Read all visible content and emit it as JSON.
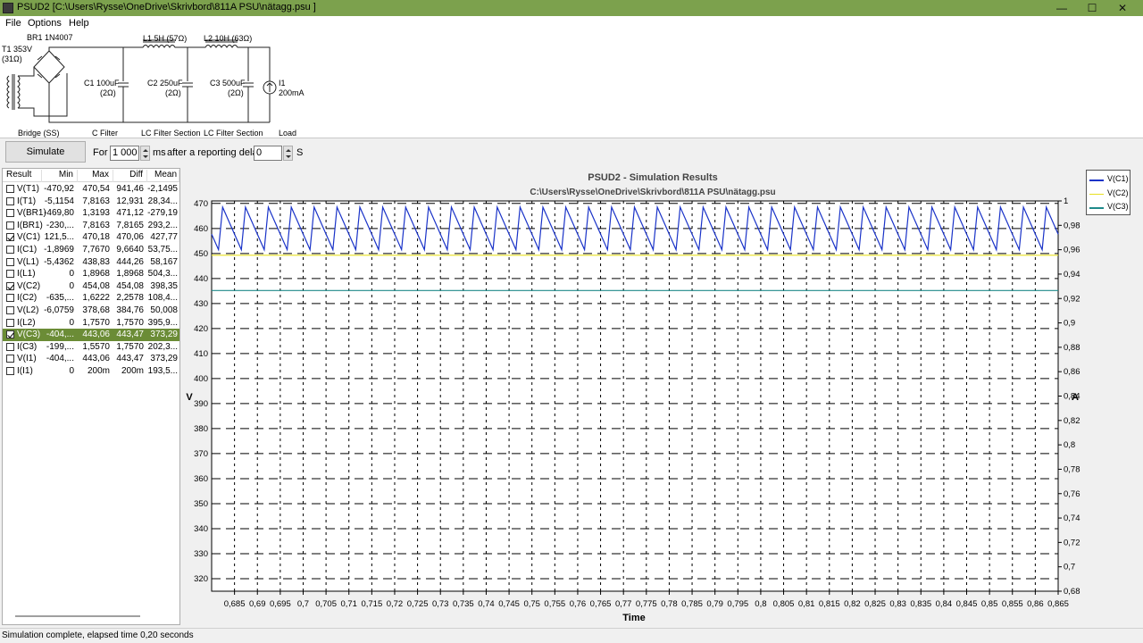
{
  "window": {
    "title": "PSUD2  [C:\\Users\\Rysse\\OneDrive\\Skrivbord\\811A PSU\\nätagg.psu ]",
    "btn_min": "—",
    "btn_max": "☐",
    "btn_close": "✕"
  },
  "menu": {
    "items": [
      "File",
      "Options",
      "Help"
    ]
  },
  "schematic": {
    "transformer": "T1 353V",
    "transformer_res": "(31Ω)",
    "bridge": "BR1 1N4007",
    "l1": "L1 5H (57Ω)",
    "l2": "L2 10H (63Ω)",
    "c1": "C1 100uF",
    "c1_res": "(2Ω)",
    "c2": "C2 250uF",
    "c2_res": "(2Ω)",
    "c3": "C3 500uF",
    "c3_res": "(2Ω)",
    "i1": "I1",
    "i1_val": "200mA",
    "sec_bridge": "Bridge (SS)",
    "sec_cfilter": "C Filter",
    "sec_lc1": "LC Filter Section",
    "sec_lc2": "LC Filter Section",
    "sec_load": "Load"
  },
  "toolbar": {
    "simulate": "Simulate",
    "for_label": "For",
    "duration": "1 000",
    "ms_label": "ms",
    "after_label": "after a reporting delay of",
    "delay": "0",
    "s_label": "S"
  },
  "results": {
    "headers": [
      "Result",
      "Min",
      "Max",
      "Diff",
      "Mean"
    ],
    "rows": [
      {
        "name": "V(T1)",
        "min": "-470,92",
        "max": "470,54",
        "diff": "941,46",
        "mean": "-2,1495",
        "checked": false,
        "selected": false
      },
      {
        "name": "I(T1)",
        "min": "-5,1154",
        "max": "7,8163",
        "diff": "12,931",
        "mean": "28,34...",
        "checked": false,
        "selected": false
      },
      {
        "name": "V(BR1)",
        "min": "-469,80",
        "max": "1,3193",
        "diff": "471,12",
        "mean": "-279,19",
        "checked": false,
        "selected": false
      },
      {
        "name": "I(BR1)",
        "min": "-230,...",
        "max": "7,8163",
        "diff": "7,8165",
        "mean": "293,2...",
        "checked": false,
        "selected": false
      },
      {
        "name": "V(C1)",
        "min": "121,5...",
        "max": "470,18",
        "diff": "470,06",
        "mean": "427,77",
        "checked": true,
        "selected": false
      },
      {
        "name": "I(C1)",
        "min": "-1,8969",
        "max": "7,7670",
        "diff": "9,6640",
        "mean": "53,75...",
        "checked": false,
        "selected": false
      },
      {
        "name": "V(L1)",
        "min": "-5,4362",
        "max": "438,83",
        "diff": "444,26",
        "mean": "58,167",
        "checked": false,
        "selected": false
      },
      {
        "name": "I(L1)",
        "min": "0",
        "max": "1,8968",
        "diff": "1,8968",
        "mean": "504,3...",
        "checked": false,
        "selected": false
      },
      {
        "name": "V(C2)",
        "min": "0",
        "max": "454,08",
        "diff": "454,08",
        "mean": "398,35",
        "checked": true,
        "selected": false
      },
      {
        "name": "I(C2)",
        "min": "-635,...",
        "max": "1,6222",
        "diff": "2,2578",
        "mean": "108,4...",
        "checked": false,
        "selected": false
      },
      {
        "name": "V(L2)",
        "min": "-6,0759",
        "max": "378,68",
        "diff": "384,76",
        "mean": "50,008",
        "checked": false,
        "selected": false
      },
      {
        "name": "I(L2)",
        "min": "0",
        "max": "1,7570",
        "diff": "1,7570",
        "mean": "395,9...",
        "checked": false,
        "selected": false
      },
      {
        "name": "V(C3)",
        "min": "-404,...",
        "max": "443,06",
        "diff": "443,47",
        "mean": "373,29",
        "checked": true,
        "selected": true
      },
      {
        "name": "I(C3)",
        "min": "-199,...",
        "max": "1,5570",
        "diff": "1,7570",
        "mean": "202,3...",
        "checked": false,
        "selected": false
      },
      {
        "name": "V(I1)",
        "min": "-404,...",
        "max": "443,06",
        "diff": "443,47",
        "mean": "373,29",
        "checked": false,
        "selected": false
      },
      {
        "name": "I(I1)",
        "min": "0",
        "max": "200m",
        "diff": "200m",
        "mean": "193,5...",
        "checked": false,
        "selected": false
      }
    ]
  },
  "status": {
    "text": "Simulation complete, elapsed time 0,20 seconds"
  },
  "chart_data": {
    "type": "line",
    "title": "PSUD2 - Simulation Results",
    "subtitle": "C:\\Users\\Rysse\\OneDrive\\Skrivbord\\811A PSU\\nätagg.psu",
    "xlabel": "Time",
    "ylabel": "V",
    "y2label": "A",
    "xlim": [
      0.68,
      0.865
    ],
    "ylim": [
      315,
      471
    ],
    "y2lim": [
      0.68,
      1.0
    ],
    "x_ticks": [
      "0,685",
      "0,69",
      "0,695",
      "0,7",
      "0,705",
      "0,71",
      "0,715",
      "0,72",
      "0,725",
      "0,73",
      "0,735",
      "0,74",
      "0,745",
      "0,75",
      "0,755",
      "0,76",
      "0,765",
      "0,77",
      "0,775",
      "0,78",
      "0,785",
      "0,79",
      "0,795",
      "0,8",
      "0,805",
      "0,81",
      "0,815",
      "0,82",
      "0,825",
      "0,83",
      "0,835",
      "0,84",
      "0,845",
      "0,85",
      "0,855",
      "0,86",
      "0,865"
    ],
    "y_ticks": [
      "470",
      "460",
      "450",
      "440",
      "430",
      "420",
      "410",
      "400",
      "390",
      "380",
      "370",
      "360",
      "350",
      "340",
      "330",
      "320"
    ],
    "y2_ticks": [
      "1",
      "0,98",
      "0,96",
      "0,94",
      "0,92",
      "0,9",
      "0,88",
      "0,86",
      "0,84",
      "0,82",
      "0,8",
      "0,78",
      "0,76",
      "0,74",
      "0,72",
      "0,7",
      "0,68"
    ],
    "grid": true,
    "legend_position": "top-right",
    "ripple_period": 0.005,
    "ripple_phase_min": 0.6815,
    "series": [
      {
        "name": "V(C1)",
        "color": "#1a33c8",
        "min": 451.5,
        "max": 468.5,
        "waveform": "sawtooth"
      },
      {
        "name": "V(C2)",
        "color": "#e8e020",
        "values": 449.3,
        "waveform": "flat"
      },
      {
        "name": "V(C3)",
        "color": "#1f8a8a",
        "values": 435.2,
        "waveform": "flat"
      }
    ]
  }
}
